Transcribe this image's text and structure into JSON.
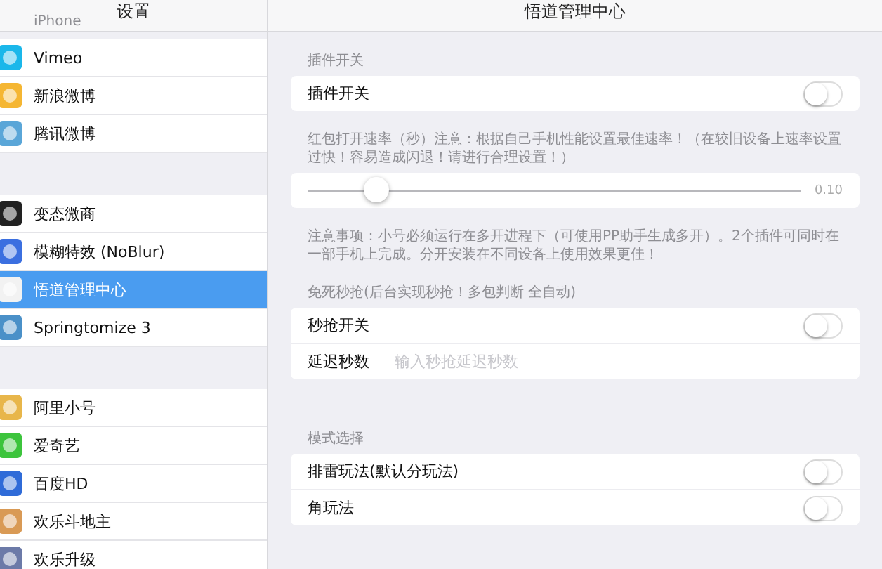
{
  "sidebar": {
    "title": "设置",
    "faded_item": "iPhone",
    "groups": [
      [
        {
          "label": "Vimeo",
          "selected": false
        },
        {
          "label": "新浪微博",
          "selected": false
        },
        {
          "label": "腾讯微博",
          "selected": false
        }
      ],
      [
        {
          "label": "变态微商",
          "selected": false
        },
        {
          "label": "模糊特效 (NoBlur)",
          "selected": false
        },
        {
          "label": "悟道管理中心",
          "selected": true
        },
        {
          "label": "Springtomize 3",
          "selected": false
        }
      ],
      [
        {
          "label": "阿里小号",
          "selected": false
        },
        {
          "label": "爱奇艺",
          "selected": false
        },
        {
          "label": "百度HD",
          "selected": false
        },
        {
          "label": "欢乐斗地主",
          "selected": false
        },
        {
          "label": "欢乐升级",
          "selected": false
        }
      ]
    ]
  },
  "detail": {
    "title": "悟道管理中心",
    "sections": [
      {
        "header": "插件开关",
        "rows": [
          {
            "kind": "toggle",
            "label": "插件开关",
            "on": false
          }
        ]
      },
      {
        "header": "红包打开速率（秒）注意：根据自己手机性能设置最佳速率！（在较旧设备上速率设置过快！容易造成闪退！请进行合理设置！）",
        "rows": [
          {
            "kind": "slider",
            "level": 0.14,
            "reading": "0.10"
          }
        ],
        "footer": "注意事项：小号必须运行在多开进程下（可使用PP助手生成多开）。2个插件可同时在一部手机上完成。分开安装在不同设备上使用效果更佳！"
      },
      {
        "header": "免死秒抢(后台实现秒抢！多包判断 全自动)",
        "rows": [
          {
            "kind": "toggle",
            "label": "秒抢开关",
            "on": false
          },
          {
            "kind": "field",
            "label": "延迟秒数",
            "placeholder": "输入秒抢延迟秒数"
          }
        ]
      },
      {
        "header": "模式选择",
        "rows": [
          {
            "kind": "toggle",
            "label": "排雷玩法(默认分玩法)",
            "on": false
          },
          {
            "kind": "toggle",
            "label": "角玩法",
            "on": false
          }
        ]
      }
    ]
  }
}
